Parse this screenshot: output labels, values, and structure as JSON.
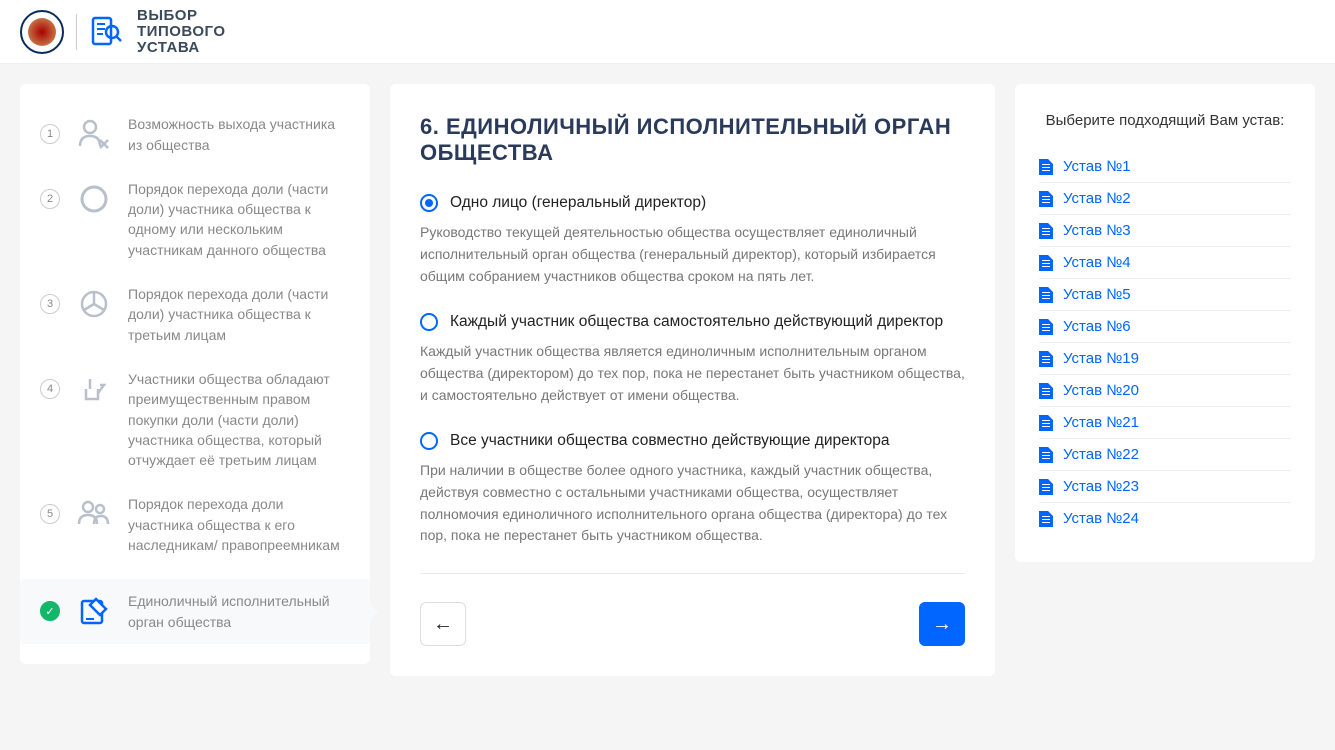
{
  "header": {
    "title_line1": "ВЫБОР",
    "title_line2": "ТИПОВОГО",
    "title_line3": "УСТАВА"
  },
  "sidebar": {
    "steps": [
      {
        "num": "1",
        "text": "Возможность выхода участника из общества",
        "active": false,
        "done": false
      },
      {
        "num": "2",
        "text": "Порядок перехода доли (части доли) участника общества к одному или нескольким участникам данного общества",
        "active": false,
        "done": false
      },
      {
        "num": "3",
        "text": "Порядок перехода доли (части доли) участника общества к третьим лицам",
        "active": false,
        "done": false
      },
      {
        "num": "4",
        "text": "Участники общества обладают преимущественным правом покупки доли (части доли) участника общества, который отчуждает её третьим лицам",
        "active": false,
        "done": false
      },
      {
        "num": "5",
        "text": "Порядок перехода доли участника общества к его наследникам/ правопреемникам",
        "active": false,
        "done": false
      },
      {
        "num": "",
        "text": "Единоличный исполнительный орган общества",
        "active": true,
        "done": true
      }
    ]
  },
  "content": {
    "heading": "6. ЕДИНОЛИЧНЫЙ ИСПОЛНИТЕЛЬНЫЙ ОРГАН ОБЩЕСТВА",
    "options": [
      {
        "label": "Одно лицо (генеральный директор)",
        "desc": "Руководство текущей деятельностью общества осуществляет единоличный исполнительный орган общества (генеральный директор), который избирается общим собранием участников общества сроком на пять лет.",
        "checked": true
      },
      {
        "label": "Каждый участник общества самостоятельно действующий директор",
        "desc": "Каждый участник общества является единоличным исполнительным органом общества (директором) до тех пор, пока не перестанет быть участником общества, и самостоятельно действует от имени общества.",
        "checked": false
      },
      {
        "label": "Все участники общества совместно действующие директора",
        "desc": "При наличии в обществе более одного участника, каждый участник общества, действуя совместно с остальными участниками общества, осуществляет полномочия единоличного исполнительного органа общества (директора) до тех пор, пока не перестанет быть участником общества.",
        "checked": false
      }
    ]
  },
  "rightbar": {
    "title": "Выберите подходящий Вам устав:",
    "docs": [
      "Устав №1",
      "Устав №2",
      "Устав №3",
      "Устав №4",
      "Устав №5",
      "Устав №6",
      "Устав №19",
      "Устав №20",
      "Устав №21",
      "Устав №22",
      "Устав №23",
      "Устав №24"
    ]
  },
  "icons": {
    "back_arrow": "←",
    "next_arrow": "→",
    "check": "✓"
  }
}
